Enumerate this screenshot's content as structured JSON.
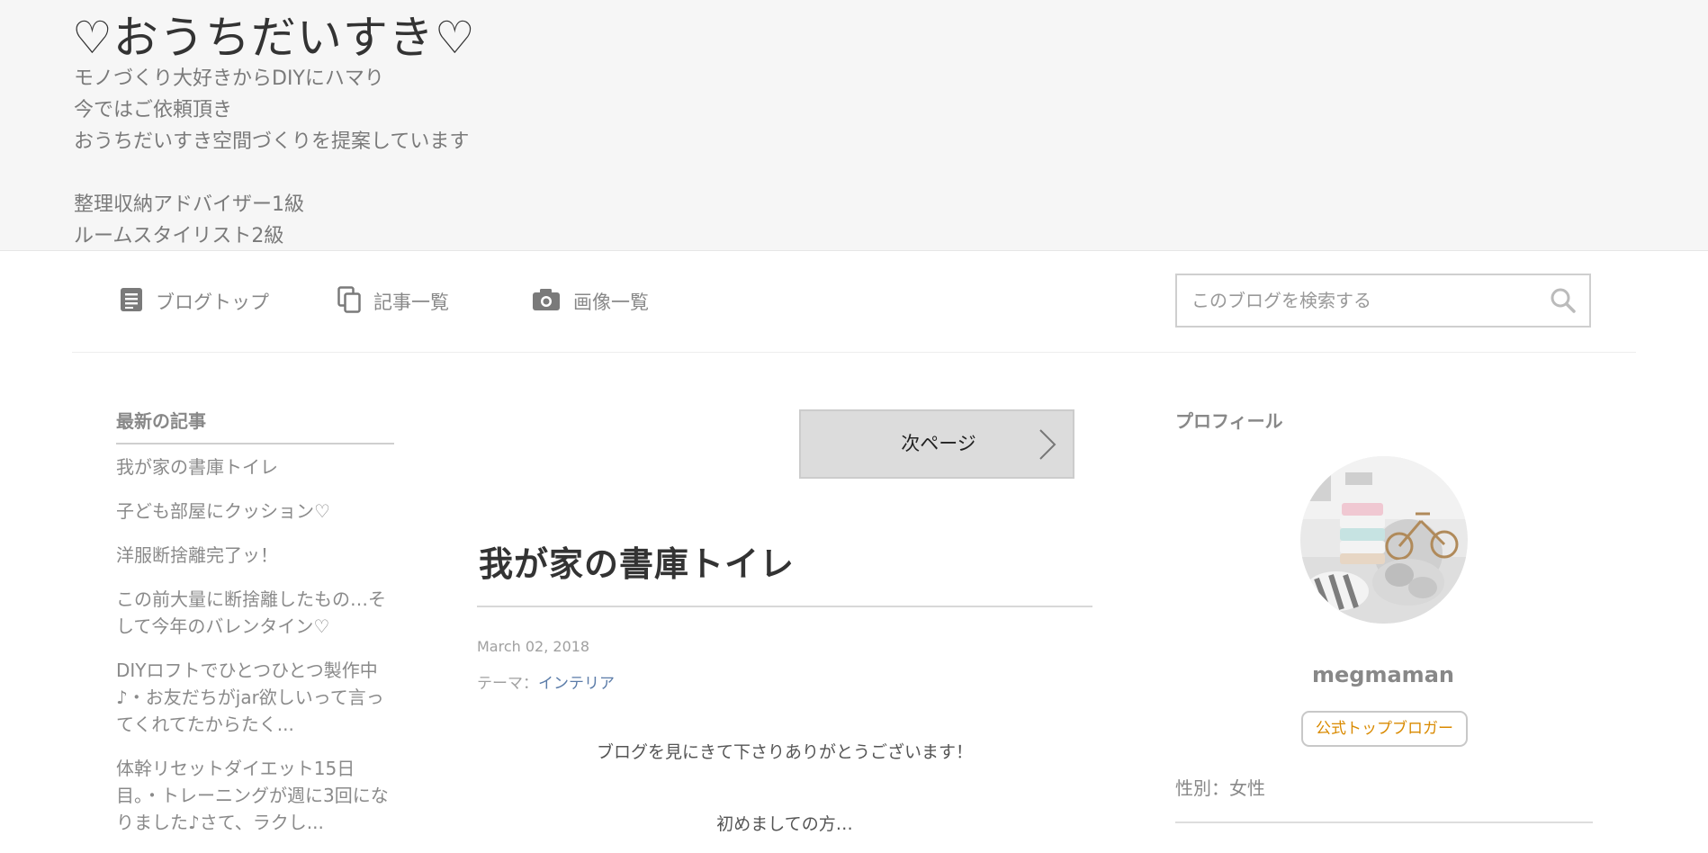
{
  "header": {
    "title": "♡おうちだいすき♡",
    "description": [
      "モノづくり大好きからDIYにハマり",
      "今ではご依頼頂き",
      "おうちだいすき空間づくりを提案しています",
      "",
      "整理収納アドバイザー1級",
      "ルームスタイリスト2級"
    ]
  },
  "nav": {
    "items": [
      {
        "label": "ブログトップ",
        "icon": "document-icon"
      },
      {
        "label": "記事一覧",
        "icon": "copy-icon"
      },
      {
        "label": "画像一覧",
        "icon": "camera-icon"
      }
    ],
    "search_placeholder": "このブログを検索する"
  },
  "sidebar": {
    "title": "最新の記事",
    "items": [
      "我が家の書庫トイレ",
      "子ども部屋にクッション♡",
      "洋服断捨離完了ッ！",
      "この前大量に断捨離したもの…そして今年のバレンタイン♡",
      "DIYロフトでひとつひとつ製作中♪・お友だちがjar欲しいって言ってくれてたからたく...",
      "体幹リセットダイエット15日目。・トレーニングが週に3回になりました♪さて、ラクし..."
    ]
  },
  "main": {
    "next_page_label": "次ページ",
    "post_title": "我が家の書庫トイレ",
    "date": "March 02, 2018",
    "theme_label": "テーマ：",
    "theme_value": "インテリア",
    "paragraph1": "ブログを見にきて下さりありがとうございます！",
    "paragraph2": "初めましての方…"
  },
  "profile": {
    "title": "プロフィール",
    "name": "megmaman",
    "badge": "公式トップブロガー",
    "gender": "性別：女性"
  },
  "colors": {
    "header_bg": "#f6f6f6",
    "accent_badge": "#d98a00",
    "link": "#5a7ba8"
  }
}
